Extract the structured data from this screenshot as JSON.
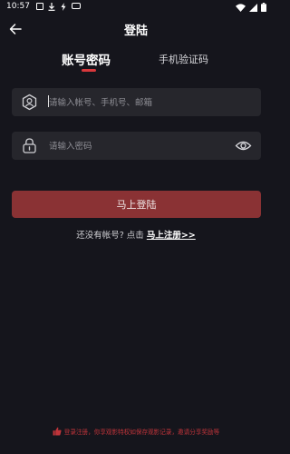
{
  "status_bar": {
    "time": "10:57"
  },
  "header": {
    "title": "登陆"
  },
  "tabs": [
    {
      "label": "账号密码",
      "active": true
    },
    {
      "label": "手机验证码",
      "active": false
    }
  ],
  "form": {
    "account_placeholder": "请输入帐号、手机号、邮箱",
    "password_placeholder": "请输入密码"
  },
  "login_button": {
    "label": "马上登陆"
  },
  "register": {
    "prompt": "还没有帐号? 点击 ",
    "link": "马上注册>>"
  },
  "footer": {
    "note": "登录注册，你享观影特权如保存观影记录，邀请分享奖励等"
  },
  "colors": {
    "background": "#15151c",
    "accent": "#d8383c",
    "button": "#8a3234",
    "input_bg": "#26262c"
  },
  "icons": {
    "back": "arrow-left-icon",
    "user": "user-icon",
    "lock": "lock-icon",
    "eye": "eye-icon",
    "thumb": "thumbs-up-icon"
  }
}
